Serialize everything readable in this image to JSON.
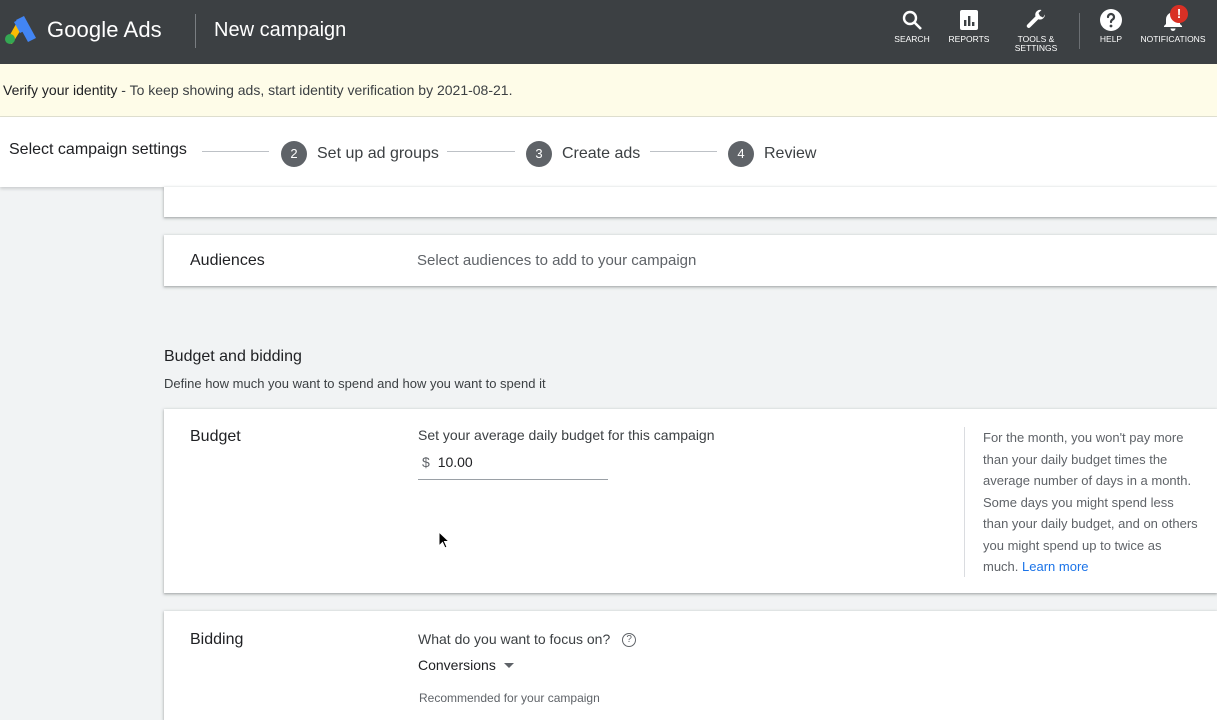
{
  "header": {
    "brand": "Google Ads",
    "page_title": "New campaign",
    "actions": {
      "search": "SEARCH",
      "reports": "REPORTS",
      "tools_line1": "TOOLS &",
      "tools_line2": "SETTINGS",
      "help": "HELP",
      "notifications": "NOTIFICATIONS"
    },
    "notification_badge": "!"
  },
  "verify": {
    "title": "Verify your identity",
    "message": " - To keep showing ads, start identity verification by 2021-08-21."
  },
  "stepper": {
    "current": "Select campaign settings",
    "steps": [
      {
        "num": "2",
        "label": "Set up ad groups"
      },
      {
        "num": "3",
        "label": "Create ads"
      },
      {
        "num": "4",
        "label": "Review"
      }
    ]
  },
  "audiences": {
    "label": "Audiences",
    "description": "Select audiences to add to your campaign"
  },
  "budget_section": {
    "title": "Budget and bidding",
    "subtitle": "Define how much you want to spend and how you want to spend it"
  },
  "budget": {
    "label": "Budget",
    "prompt": "Set your average daily budget for this campaign",
    "currency": "$",
    "value": "10.00",
    "help": "For the month, you won't pay more than your daily budget times the average number of days in a month. Some days you might spend less than your daily budget, and on others you might spend up to twice as much.",
    "learn_more": "Learn more"
  },
  "bidding": {
    "label": "Bidding",
    "question": "What do you want to focus on?",
    "help_icon": "?",
    "selected": "Conversions",
    "note": "Recommended for your campaign"
  },
  "colors": {
    "topbar": "#3c4043",
    "accent": "#1a73e8",
    "banner": "#fefce8",
    "badge": "#d93025"
  }
}
